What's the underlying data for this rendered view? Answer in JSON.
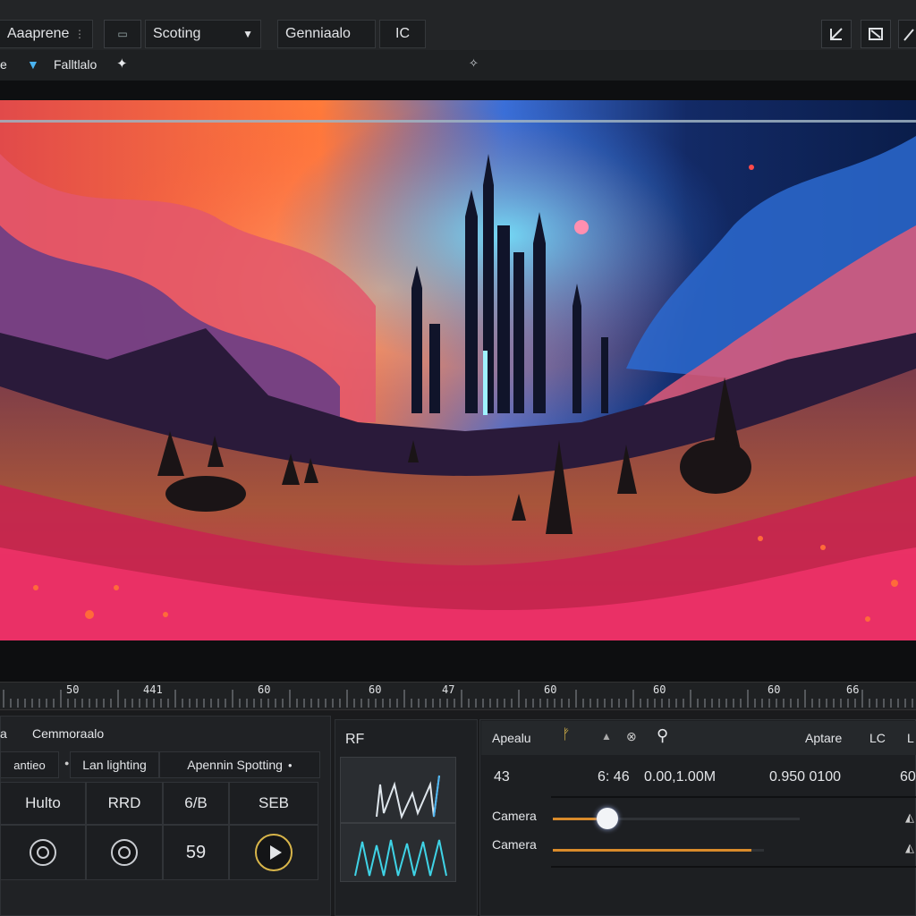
{
  "toolbar": {
    "app_name": "Aaaprene",
    "preset_select": "Scoting",
    "mode_tab": "Genniaalo",
    "zoom_tab": "IC"
  },
  "subbar": {
    "left_label": "e",
    "filter_label": "Falltlalo"
  },
  "ruler": {
    "ticks": [
      "50",
      "441",
      "60",
      "60",
      "47",
      "60",
      "60",
      "60",
      "66"
    ]
  },
  "left_panel": {
    "title_prefix": "a",
    "title": "Cemmoraalo",
    "tabs": [
      "antieo",
      "Lan lighting",
      "Apennin Spotting"
    ],
    "grid_headers": [
      "Hulto",
      "RRD",
      "6/B",
      "SEB"
    ],
    "mid_value": "59"
  },
  "rf_panel": {
    "title": "RF"
  },
  "right_panel": {
    "title": "Apealu",
    "right_title": "Aptare",
    "right_code": "LC",
    "right_code2": "L",
    "value_left": "43",
    "value_mid": "6: 46",
    "value_mid2": "0.00,1.00M",
    "value_right": "0.950 0100",
    "value_far": "60",
    "slider1_label": "Camera",
    "slider2_label": "Camera",
    "slider1_level": 0.22,
    "slider2_level": 0.94
  },
  "colors": {
    "accent": "#d98b2b",
    "play_ring": "#d8b54a"
  }
}
